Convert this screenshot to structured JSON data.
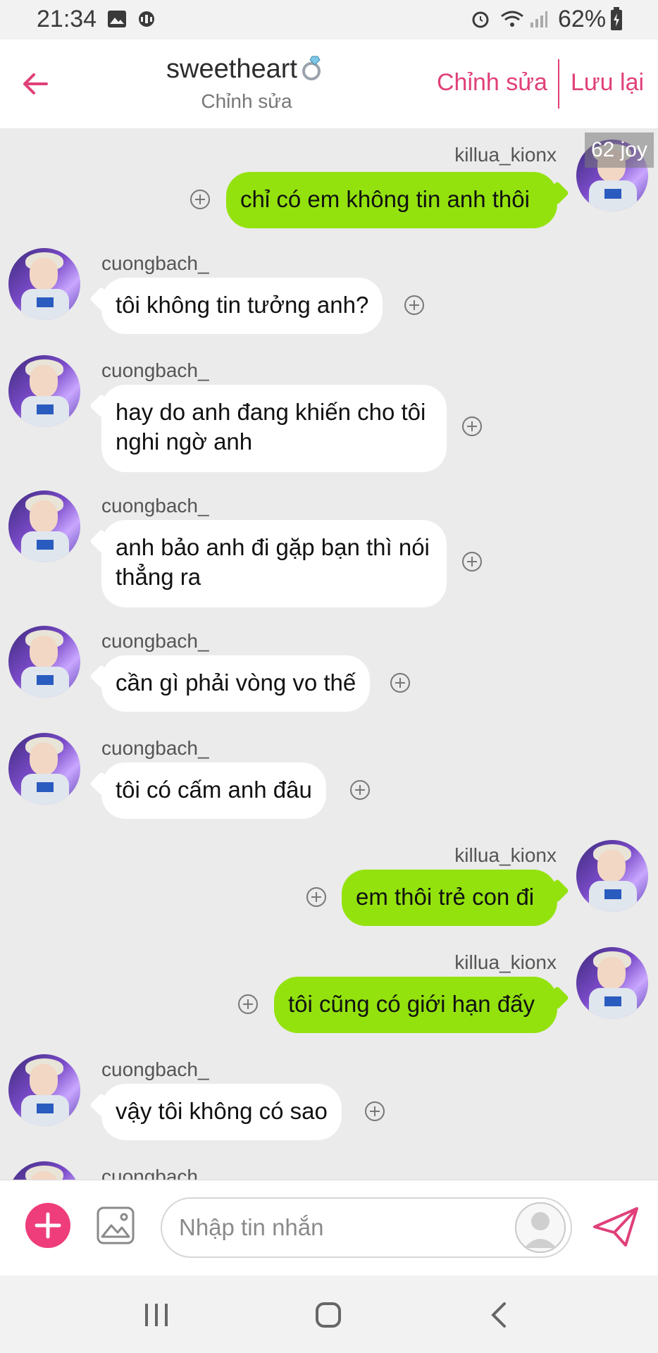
{
  "status_bar": {
    "time": "21:34",
    "battery": "62%"
  },
  "header": {
    "title": "sweetheart",
    "subtitle": "Chỉnh sửa",
    "edit_label": "Chỉnh sửa",
    "save_label": "Lưu lại"
  },
  "watermark": "62 joy",
  "messages": [
    {
      "side": "right",
      "sender": "killua_kionx",
      "text": "chỉ có em không tin anh thôi"
    },
    {
      "side": "left",
      "sender": "cuongbach_",
      "text": "tôi không tin tưởng anh?"
    },
    {
      "side": "left",
      "sender": "cuongbach_",
      "text": "hay do anh đang khiến cho tôi nghi ngờ anh"
    },
    {
      "side": "left",
      "sender": "cuongbach_",
      "text": "anh bảo anh đi gặp bạn thì nói thẳng ra"
    },
    {
      "side": "left",
      "sender": "cuongbach_",
      "text": "cần gì phải vòng vo thế"
    },
    {
      "side": "left",
      "sender": "cuongbach_",
      "text": "tôi có cấm anh đâu"
    },
    {
      "side": "right",
      "sender": "killua_kionx",
      "text": "em thôi trẻ con đi"
    },
    {
      "side": "right",
      "sender": "killua_kionx",
      "text": "tôi cũng có giới hạn đấy"
    },
    {
      "side": "left",
      "sender": "cuongbach_",
      "text": "vậy tôi không có sao"
    },
    {
      "side": "left",
      "sender": "cuongbach_",
      "text": ""
    }
  ],
  "input": {
    "placeholder": "Nhập tin nhắn"
  },
  "colors": {
    "accent": "#e0407a",
    "sent_bubble": "#93e20e",
    "received_bubble": "#ffffff",
    "background": "#ebebeb"
  },
  "icons": [
    "arrow-left-icon",
    "ring-icon",
    "plus-circle-icon",
    "add-icon",
    "image-icon",
    "avatar-placeholder-icon",
    "send-icon",
    "recent-apps-icon",
    "home-icon",
    "back-nav-icon"
  ]
}
